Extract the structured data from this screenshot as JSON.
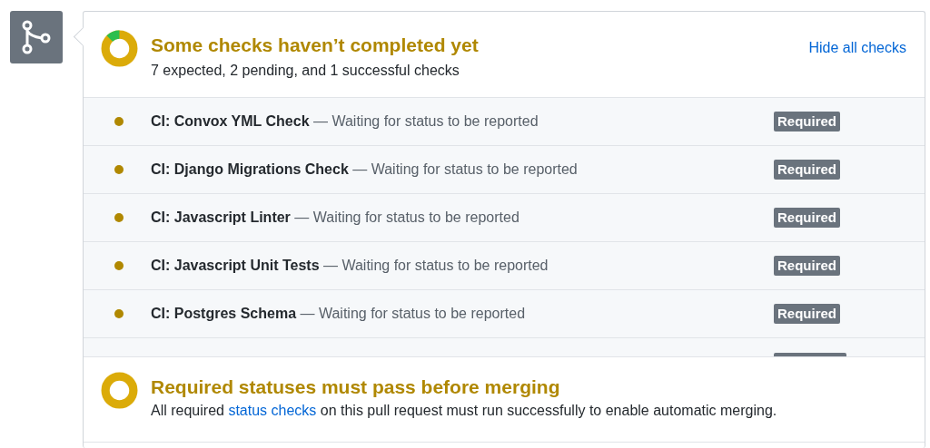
{
  "header": {
    "title": "Some checks haven’t completed yet",
    "summary": "7 expected, 2 pending, and 1 successful checks",
    "toggle_link": "Hide all checks"
  },
  "checks": [
    {
      "color": "#b08800",
      "text": "**CI: Convox YML Check** — Waiting for status to be reported",
      "badge": "Required"
    },
    {
      "color": "#b08800",
      "text": "**CI: Django Migrations Check** — Waiting for status to be reported",
      "badge": "Required"
    },
    {
      "color": "#b08800",
      "text": "**CI: Javascript Linter** — Waiting for status to be reported",
      "badge": "Required"
    },
    {
      "color": "#b08800",
      "text": "**CI: Javascript Unit Tests** — Waiting for status to be reported",
      "badge": "Required"
    },
    {
      "color": "#b08800",
      "text": "**CI: Postgres Schema** — Waiting for status to be reported",
      "badge": "Required"
    }
  ],
  "merge": {
    "title": "Required statuses must pass before merging",
    "message_before": "All required",
    "link": "status checks",
    "message_after": "on this pull request must run successfully to enable automatic merging."
  }
}
